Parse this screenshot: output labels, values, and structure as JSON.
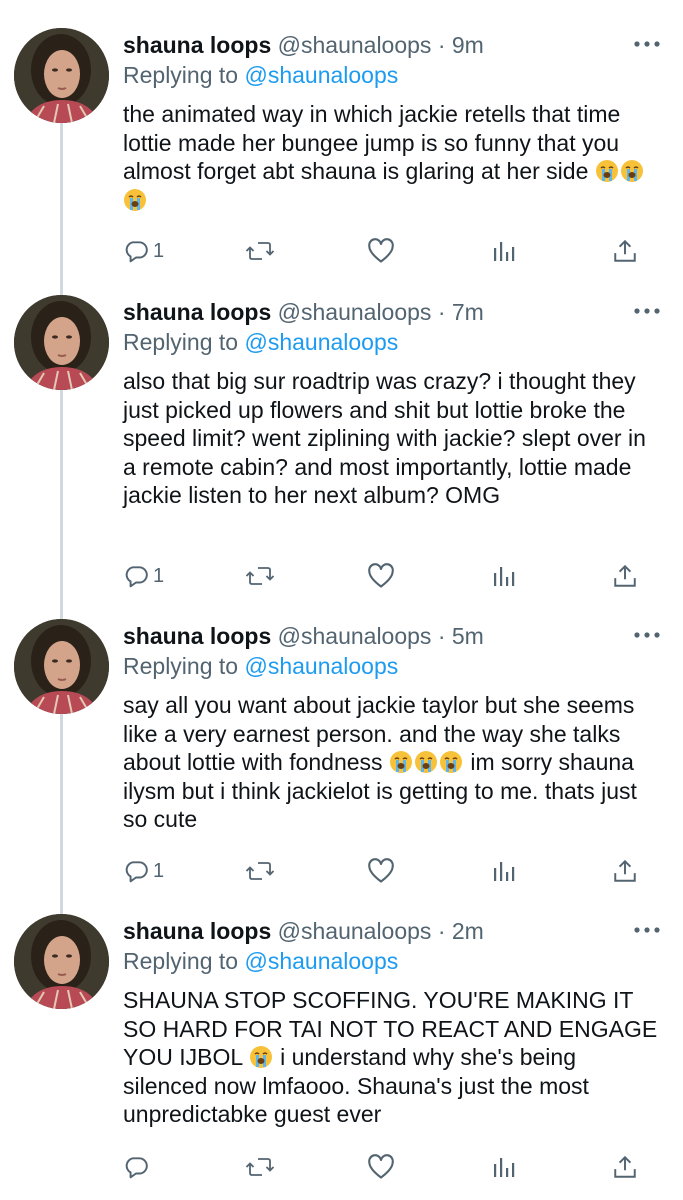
{
  "tweets": [
    {
      "display_name": "shauna loops",
      "handle": "@shaunaloops",
      "separator": "·",
      "time": "9m",
      "replying_prefix": "Replying to",
      "replying_handle": "@shaunaloops",
      "text": "the animated way in which jackie retells that time lottie made her bungee jump is so funny that you almost forget abt shauna is glaring at her side",
      "reply_count": "1"
    },
    {
      "display_name": "shauna loops",
      "handle": "@shaunaloops",
      "separator": "·",
      "time": "7m",
      "replying_prefix": "Replying to",
      "replying_handle": "@shaunaloops",
      "text": "also that big sur roadtrip was crazy? i thought they just picked up flowers and shit but lottie broke the speed limit? went ziplining with jackie? slept over in a remote cabin? and most importantly, lottie made jackie listen to her next album? OMG",
      "reply_count": "1"
    },
    {
      "display_name": "shauna loops",
      "handle": "@shaunaloops",
      "separator": "·",
      "time": "5m",
      "replying_prefix": "Replying to",
      "replying_handle": "@shaunaloops",
      "text_part1": "say all you want about jackie taylor but she seems like a very earnest person. and the way she talks about lottie with fondness",
      "text_part2": "im sorry shauna ilysm but i think jackielot is getting to me. thats just so cute",
      "reply_count": "1"
    },
    {
      "display_name": "shauna loops",
      "handle": "@shaunaloops",
      "separator": "·",
      "time": "2m",
      "replying_prefix": "Replying to",
      "replying_handle": "@shaunaloops",
      "text_part1": "SHAUNA STOP SCOFFING. YOU'RE MAKING IT SO HARD FOR TAI NOT TO REACT AND ENGAGE YOU IJBOL",
      "text_part2": "i understand why she's being silenced now lmfaooo. Shauna's just the most unpredictabke guest ever",
      "reply_count": ""
    }
  ],
  "icons": {
    "avatar": "profile-photo",
    "more": "more-horizontal-icon",
    "reply": "reply-bubble-icon",
    "retweet": "retweet-icon",
    "like": "heart-icon",
    "views": "analytics-bars-icon",
    "share": "share-upload-icon",
    "emoji": "loudly-crying-face-emoji"
  },
  "colors": {
    "text": "#0f1419",
    "muted": "#536471",
    "link": "#1d9bf0",
    "thread_line": "#cfd9de"
  }
}
